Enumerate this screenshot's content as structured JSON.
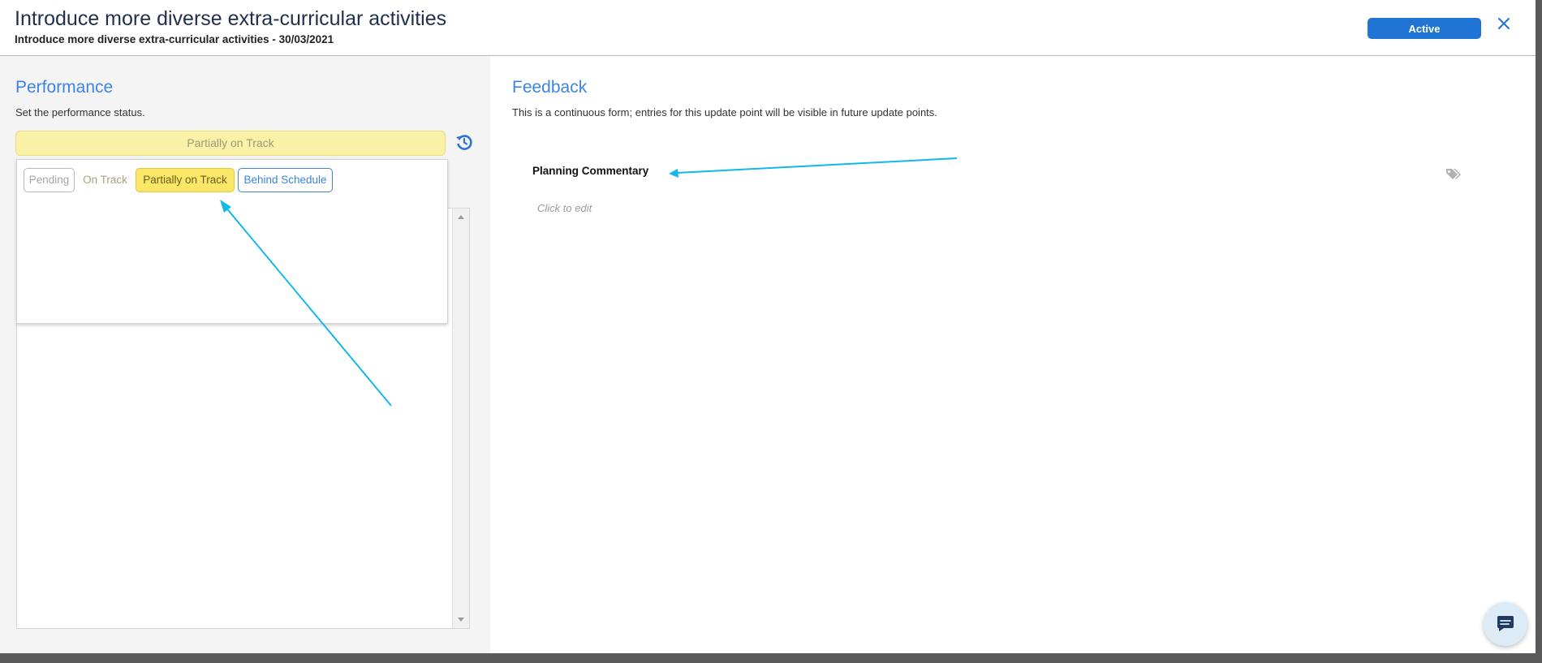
{
  "header": {
    "title": "Introduce more diverse extra-curricular activities",
    "subtitle": "Introduce more diverse extra-curricular activities - 30/03/2021",
    "status_button": "Active",
    "close_icon": "close-icon"
  },
  "performance": {
    "title": "Performance",
    "description": "Set the performance status.",
    "selected_status": "Partially on Track",
    "history_icon": "history-icon",
    "options": [
      {
        "label": "Pending"
      },
      {
        "label": "On Track"
      },
      {
        "label": "Partially on Track"
      },
      {
        "label": "Behind Schedule"
      }
    ]
  },
  "feedback": {
    "title": "Feedback",
    "description": "This is a continuous form; entries for this update point will be visible in future update points.",
    "field_label": "Planning Commentary",
    "placeholder": "Click to edit",
    "tag_icon": "tag-icon"
  },
  "chat": {
    "icon": "chat-icon"
  },
  "colors": {
    "accent": "#3d84e0",
    "active_button": "#1f74d4",
    "partial_highlight": "#fbe767",
    "annotation_arrow": "#12b8ea"
  }
}
